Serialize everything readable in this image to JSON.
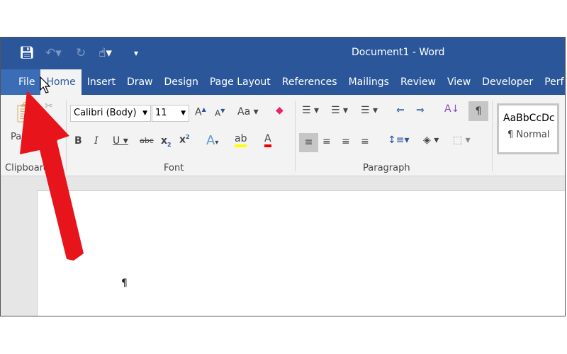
{
  "window": {
    "title": "Document1  -  Word"
  },
  "quick_access": {
    "save_icon": "save-icon",
    "undo_icon": "undo-icon",
    "redo_icon": "redo-icon",
    "touch_icon": "touch-mode-icon",
    "customize": "▾"
  },
  "tabs": [
    "File",
    "Home",
    "Insert",
    "Draw",
    "Design",
    "Page Layout",
    "References",
    "Mailings",
    "Review",
    "View",
    "Developer",
    "Perf"
  ],
  "ribbon": {
    "clipboard": {
      "label": "Clipboard",
      "paste": "Paste"
    },
    "font": {
      "label": "Font",
      "font_name": "Calibri (Body)",
      "font_size": "11",
      "change_case": "Aa"
    },
    "paragraph": {
      "label": "Paragraph"
    },
    "styles": {
      "preview": "AaBbCcDc",
      "name": "¶ Normal"
    }
  },
  "document": {
    "pilcrow": "¶"
  },
  "annotation": {
    "arrow_color": "#e8141b"
  }
}
